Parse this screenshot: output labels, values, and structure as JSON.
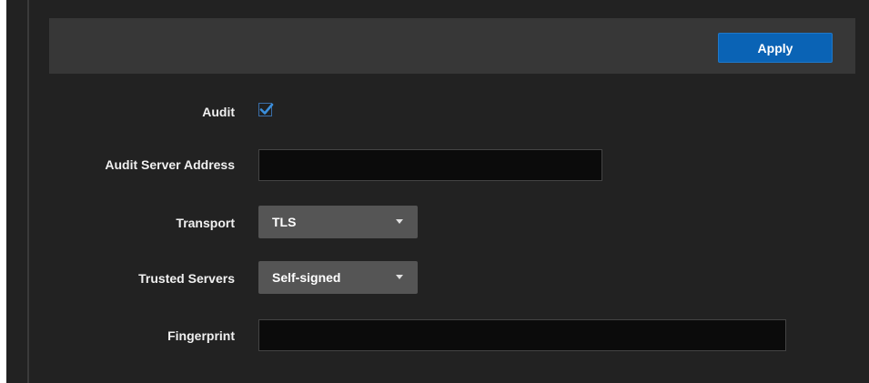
{
  "toolbar": {
    "apply_label": "Apply"
  },
  "form": {
    "audit": {
      "label": "Audit",
      "checked": true
    },
    "audit_server_address": {
      "label": "Audit Server Address",
      "value": ""
    },
    "transport": {
      "label": "Transport",
      "selected": "TLS"
    },
    "trusted_servers": {
      "label": "Trusted Servers",
      "selected": "Self-signed"
    },
    "fingerprint": {
      "label": "Fingerprint",
      "value": ""
    }
  },
  "icons": {
    "checkmark": "check-icon",
    "dropdown": "caret-down-icon"
  },
  "colors": {
    "background": "#222222",
    "toolbar": "#373737",
    "accent": "#0a63b5",
    "select_bg": "#555555",
    "input_bg": "#0b0b0b",
    "check": "#3b8fdc"
  }
}
